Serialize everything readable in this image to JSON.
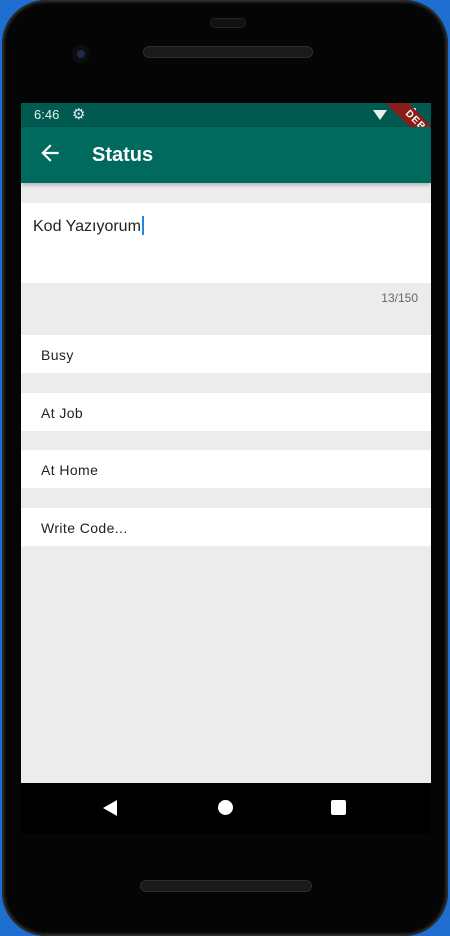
{
  "status_bar": {
    "time": "6:46",
    "debug_banner": "DEBUG"
  },
  "app_bar": {
    "title": "Status",
    "back_icon": "arrow-back-icon"
  },
  "status_input": {
    "value": "Kod Yazıyorum",
    "counter": "13/150"
  },
  "options": [
    {
      "label": "Busy"
    },
    {
      "label": "At Job"
    },
    {
      "label": "At Home"
    },
    {
      "label": "Write Code..."
    }
  ],
  "colors": {
    "app_bar": "#006a5e",
    "status_bar": "#005a4f",
    "background": "#ececec",
    "caret": "#1e88e5"
  },
  "nav_bar": {
    "icons": [
      "back-triangle-icon",
      "home-circle-icon",
      "recents-square-icon"
    ]
  }
}
